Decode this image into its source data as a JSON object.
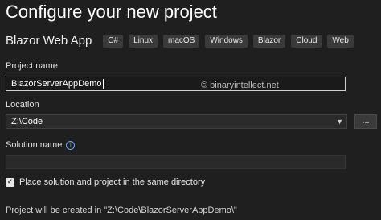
{
  "page": {
    "title": "Configure your new project"
  },
  "template": {
    "name": "Blazor Web App",
    "tags": [
      "C#",
      "Linux",
      "macOS",
      "Windows",
      "Blazor",
      "Cloud",
      "Web"
    ]
  },
  "fields": {
    "project_name": {
      "label": "Project name",
      "value": "BlazorServerAppDemo"
    },
    "location": {
      "label": "Location",
      "value": "Z:\\Code",
      "browse_label": "..."
    },
    "solution_name": {
      "label": "Solution name",
      "value": ""
    }
  },
  "watermark": "© binaryintellect.net",
  "checkbox": {
    "label": "Place solution and project in the same directory",
    "checked": true
  },
  "footer": {
    "text": "Project will be created in \"Z:\\Code\\BlazorServerAppDemo\\\""
  },
  "icons": {
    "dropdown": "chevron-down-icon",
    "info": "info-icon",
    "check": "checkmark-icon"
  }
}
